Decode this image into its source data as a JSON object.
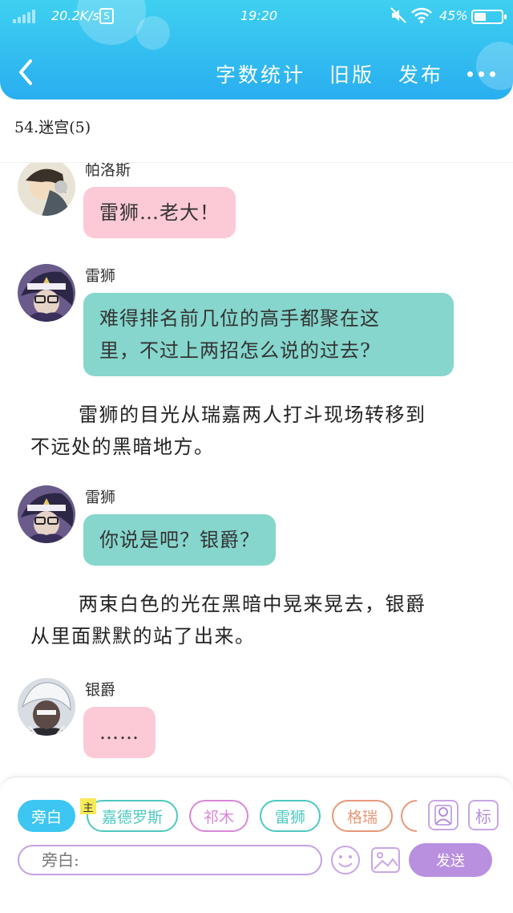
{
  "status_bar": {
    "net_speed": "20.2K/s",
    "sim_label": "S",
    "time": "19:20",
    "battery_pct": "45%",
    "battery_level": 0.45
  },
  "nav": {
    "back_icon": "chevron-left-icon",
    "word_count": "字数统计",
    "old_version": "旧版",
    "publish": "发布",
    "more_icon": "more-dots-icon"
  },
  "chapter": {
    "title": "54.迷宫(5)"
  },
  "conversation": [
    {
      "speaker": "帕洛斯",
      "text": "雷狮…老大！",
      "style": "pink"
    },
    {
      "speaker": "雷狮",
      "line1": "难得排名前几位的高手都聚在这",
      "line2": "里，不过上两招怎么说的过去?",
      "style": "teal"
    },
    {
      "narration_line1": "雷狮的目光从瑞嘉两人打斗现场转移到",
      "narration_line2": "不远处的黑暗地方。"
    },
    {
      "speaker": "雷狮",
      "text": "你说是吧？银爵？",
      "style": "teal"
    },
    {
      "narration_line1": "两束白色的光在黑暗中晃来晃去，银爵",
      "narration_line2": "从里面默默的站了出来。"
    },
    {
      "speaker": "银爵",
      "text": "……",
      "style": "pink"
    }
  ],
  "bottom": {
    "chips": [
      {
        "label": "旁白",
        "color": "#3cc6f1",
        "active": true
      },
      {
        "label": "嘉德罗斯",
        "color": "#4ec8c0"
      },
      {
        "label": "祁木",
        "color": "#d987d8"
      },
      {
        "label": "雷狮",
        "color": "#4ec8c0"
      },
      {
        "label": "格瑞",
        "color": "#e79878"
      }
    ],
    "main_tag": "主",
    "mark_label": "标",
    "input_placeholder": "旁白:",
    "send_label": "发送",
    "colors": {
      "accent": "#3cc6f1",
      "purple": "#b98fe0"
    }
  }
}
